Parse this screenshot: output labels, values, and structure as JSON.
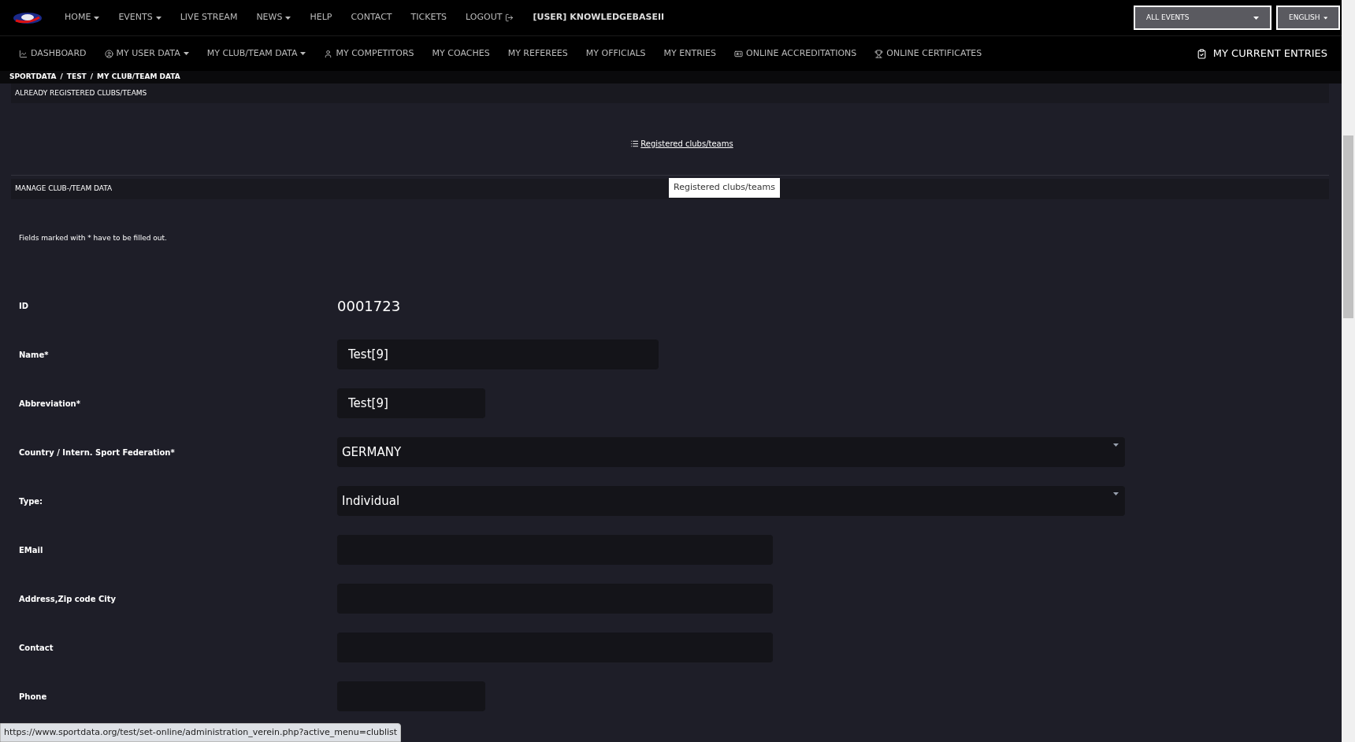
{
  "top_nav": {
    "items": [
      {
        "label": "HOME",
        "has_menu": true
      },
      {
        "label": "EVENTS",
        "has_menu": true
      },
      {
        "label": "LIVE STREAM",
        "has_menu": false
      },
      {
        "label": "NEWS",
        "has_menu": true
      },
      {
        "label": "HELP",
        "has_menu": false
      },
      {
        "label": "CONTACT",
        "has_menu": false
      },
      {
        "label": "TICKETS",
        "has_menu": false
      },
      {
        "label": "LOGOUT",
        "has_menu": false
      },
      {
        "label": "[USER] KNOWLEDGEBASEII",
        "has_menu": false
      }
    ],
    "event_select": "ALL EVENTS",
    "language_select": "ENGLISH"
  },
  "sub_nav": {
    "items": [
      {
        "label": "DASHBOARD",
        "has_menu": false
      },
      {
        "label": "MY USER DATA",
        "has_menu": true
      },
      {
        "label": "MY CLUB/TEAM DATA",
        "has_menu": true
      },
      {
        "label": "MY COMPETITORS",
        "has_menu": false
      },
      {
        "label": "MY COACHES",
        "has_menu": false
      },
      {
        "label": "MY REFEREES",
        "has_menu": false
      },
      {
        "label": "MY OFFICIALS",
        "has_menu": false
      },
      {
        "label": "MY ENTRIES",
        "has_menu": false
      },
      {
        "label": "ONLINE ACCREDITATIONS",
        "has_menu": false
      },
      {
        "label": "ONLINE CERTIFICATES",
        "has_menu": false
      }
    ],
    "current_entries": "MY CURRENT ENTRIES"
  },
  "breadcrumb": {
    "separator": "/",
    "items": [
      "SPORTDATA",
      "TEST",
      "MY CLUB/TEAM DATA"
    ]
  },
  "registered_section": {
    "title": "ALREADY REGISTERED CLUBS/TEAMS",
    "link": "Registered clubs/teams",
    "tooltip": "Registered clubs/teams"
  },
  "manage_section": {
    "title": "MANAGE CLUB-/TEAM DATA",
    "note": "Fields marked with * have to be filled out.",
    "fields": [
      {
        "label": "ID",
        "kind": "static",
        "value": "0001723"
      },
      {
        "label": "Name*",
        "kind": "text",
        "value": "Test[9]"
      },
      {
        "label": "Abbreviation*",
        "kind": "text",
        "value": "Test[9]"
      },
      {
        "label": "Country / Intern. Sport Federation*",
        "kind": "select",
        "value": "GERMANY"
      },
      {
        "label": "Type:",
        "kind": "select",
        "value": "Individual"
      },
      {
        "label": "EMail",
        "kind": "text"
      },
      {
        "label": "Address,Zip code City",
        "kind": "text"
      },
      {
        "label": "Contact",
        "kind": "text"
      },
      {
        "label": "Phone",
        "kind": "text"
      }
    ]
  },
  "status_bar": {
    "url": "https://www.sportdata.org/test/set-online/administration_verein.php?active_menu=clublist"
  }
}
